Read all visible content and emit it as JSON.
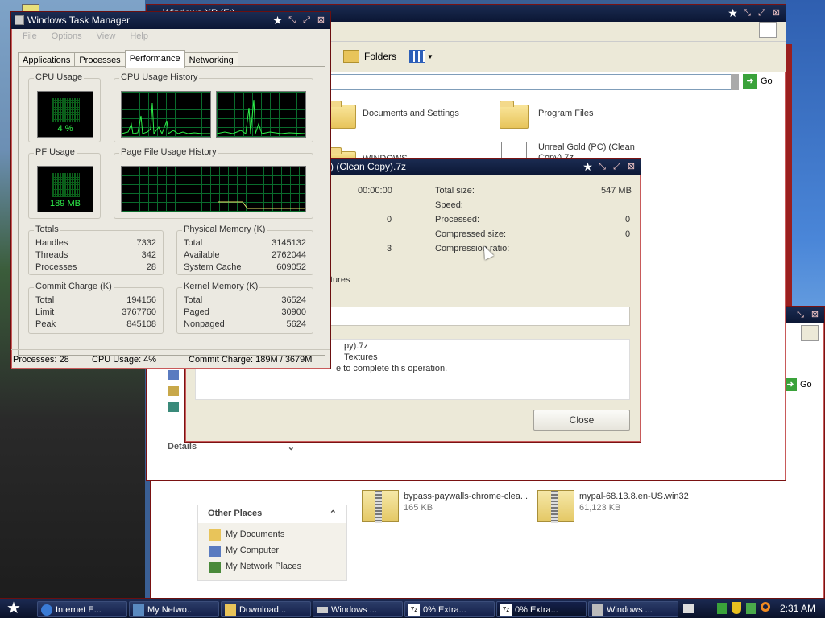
{
  "task_manager": {
    "title": "Windows Task Manager",
    "menu": [
      "File",
      "Options",
      "View",
      "Help"
    ],
    "tabs": [
      "Applications",
      "Processes",
      "Performance",
      "Networking"
    ],
    "active_tab": "Performance",
    "cpu_usage": {
      "label": "CPU Usage",
      "value": "4 %"
    },
    "cpu_history": {
      "label": "CPU Usage History"
    },
    "pf_usage": {
      "label": "PF Usage",
      "value": "189 MB"
    },
    "pf_history": {
      "label": "Page File Usage History"
    },
    "totals": {
      "label": "Totals",
      "rows": [
        {
          "k": "Handles",
          "v": "7332"
        },
        {
          "k": "Threads",
          "v": "342"
        },
        {
          "k": "Processes",
          "v": "28"
        }
      ]
    },
    "physical": {
      "label": "Physical Memory (K)",
      "rows": [
        {
          "k": "Total",
          "v": "3145132"
        },
        {
          "k": "Available",
          "v": "2762044"
        },
        {
          "k": "System Cache",
          "v": "609052"
        }
      ]
    },
    "commit": {
      "label": "Commit Charge (K)",
      "rows": [
        {
          "k": "Total",
          "v": "194156"
        },
        {
          "k": "Limit",
          "v": "3767760"
        },
        {
          "k": "Peak",
          "v": "845108"
        }
      ]
    },
    "kernel": {
      "label": "Kernel Memory (K)",
      "rows": [
        {
          "k": "Total",
          "v": "36524"
        },
        {
          "k": "Paged",
          "v": "30900"
        },
        {
          "k": "Nonpaged",
          "v": "5624"
        }
      ]
    },
    "status": {
      "processes": "Processes: 28",
      "cpu": "CPU Usage: 4%",
      "commit": "Commit Charge: 189M / 3679M"
    }
  },
  "explorer": {
    "title": "Windows XP (F:)",
    "folders_button": "Folders",
    "go_label": "Go",
    "items": [
      {
        "name": "Documents and Settings"
      },
      {
        "name": "Program Files"
      },
      {
        "name": "WINDOWS"
      },
      {
        "name": "Unreal Gold (PC) (Clean Copy).7z"
      }
    ],
    "details_label": "Details"
  },
  "explorer2": {
    "go_label": "Go",
    "other_places": {
      "title": "Other Places",
      "items": [
        "My Documents",
        "My Computer",
        "My Network Places"
      ]
    },
    "files": [
      {
        "name": "bypass-paywalls-chrome-clea...",
        "size": "165 KB"
      },
      {
        "name": "mypal-68.13.8.en-US.win32",
        "size": "61,123 KB"
      }
    ]
  },
  "zip_dialog": {
    "title": ") (Clean Copy).7z",
    "elapsed": "00:00:00",
    "left_vals": [
      "0",
      "3"
    ],
    "total_size_label": "Total size:",
    "total_size": "547 MB",
    "speed_label": "Speed:",
    "processed_label": "Processed:",
    "processed": "0",
    "compressed_label": "Compressed size:",
    "compressed": "0",
    "ratio_label": "Compression ratio:",
    "partial_label": "tures",
    "messages": [
      "py).7z",
      "Textures",
      "e to complete this operation."
    ],
    "close_label": "Close"
  },
  "taskbar": {
    "items": [
      {
        "label": "Internet E...",
        "icon": "ie-icon"
      },
      {
        "label": "My Netwo...",
        "icon": "network-icon"
      },
      {
        "label": "Download...",
        "icon": "folder-icon"
      },
      {
        "label": "Windows ...",
        "icon": "drive-icon"
      },
      {
        "label": "0% Extra...",
        "icon": "7zip-icon"
      },
      {
        "label": "0% Extra...",
        "icon": "7zip-icon"
      },
      {
        "label": "Windows ...",
        "icon": "taskmgr-icon"
      }
    ],
    "clock": "2:31 AM"
  },
  "colors": {
    "accent": "#7a1212",
    "titlebar": "#0b1634",
    "graph": "#2ef04a"
  }
}
